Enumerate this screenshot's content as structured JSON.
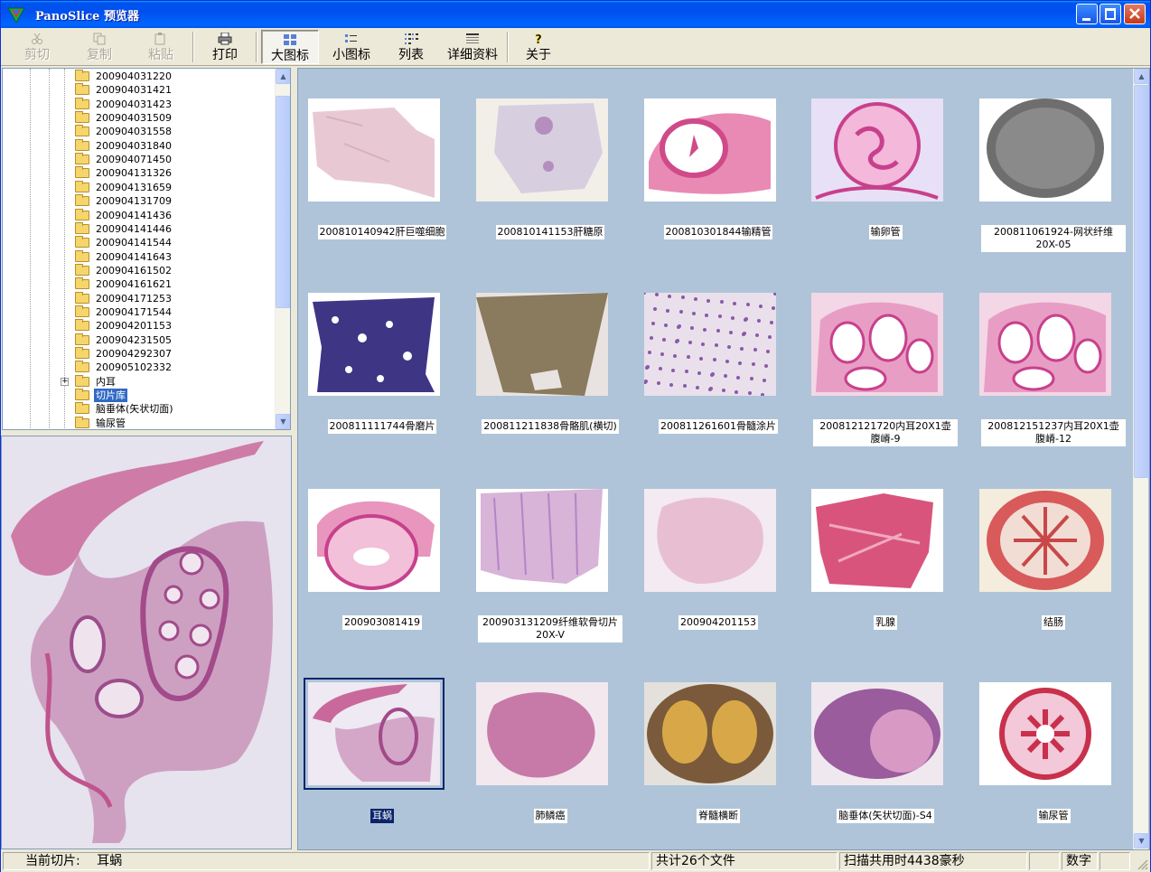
{
  "app": {
    "title": "PanoSlice 预览器"
  },
  "toolbar": {
    "cut": "剪切",
    "copy": "复制",
    "paste": "粘贴",
    "print": "打印",
    "large_icons": "大图标",
    "small_icons": "小图标",
    "list": "列表",
    "details": "详细资料",
    "about": "关于"
  },
  "tree": {
    "items": [
      "200904031220",
      "200904031421",
      "200904031423",
      "200904031509",
      "200904031558",
      "200904031840",
      "200904071450",
      "200904131326",
      "200904131659",
      "200904131709",
      "200904141436",
      "200904141446",
      "200904141544",
      "200904141643",
      "200904161502",
      "200904161621",
      "200904171253",
      "200904171544",
      "200904201153",
      "200904231505",
      "200904292307",
      "200905102332"
    ],
    "folders_lower": [
      "内耳",
      "切片库",
      "脑垂体(矢状切面)",
      "输尿管"
    ],
    "selected": "切片库"
  },
  "thumbnails": [
    {
      "caption": "200810140942肝巨噬细胞",
      "style": "t1"
    },
    {
      "caption": "200810141153肝糖原",
      "style": "t2"
    },
    {
      "caption": "200810301844输精管",
      "style": "t3"
    },
    {
      "caption": "输卵管",
      "style": "t4"
    },
    {
      "caption": "200811061924-网状纤维20X-05",
      "style": "t5"
    },
    {
      "caption": "200811111744骨磨片",
      "style": "t6"
    },
    {
      "caption": "200811211838骨骼肌(横切)",
      "style": "t7"
    },
    {
      "caption": "200811261601骨髓涂片",
      "style": "t8"
    },
    {
      "caption": "200812121720内耳20X1壶腹嵴-9",
      "style": "t9"
    },
    {
      "caption": "200812151237内耳20X1壶腹嵴-12",
      "style": "t9"
    },
    {
      "caption": "200903081419",
      "style": "t11"
    },
    {
      "caption": "200903131209纤维软骨切片20X-V",
      "style": "t12"
    },
    {
      "caption": "200904201153",
      "style": "t13"
    },
    {
      "caption": "乳腺",
      "style": "t14"
    },
    {
      "caption": "结肠",
      "style": "t15"
    },
    {
      "caption": "耳蜗",
      "style": "t16"
    },
    {
      "caption": "肺鳞癌",
      "style": "t17"
    },
    {
      "caption": "脊髓横断",
      "style": "t18"
    },
    {
      "caption": "脑垂体(矢状切面)-S4",
      "style": "t19"
    },
    {
      "caption": "输尿管",
      "style": "t20"
    }
  ],
  "selected_thumbnail": "耳蜗",
  "status": {
    "current_label": "当前切片:",
    "current_value": "耳蜗",
    "file_count": "共计26个文件",
    "scan_time": "扫描共用时4438豪秒",
    "num_indicator": "数字"
  }
}
